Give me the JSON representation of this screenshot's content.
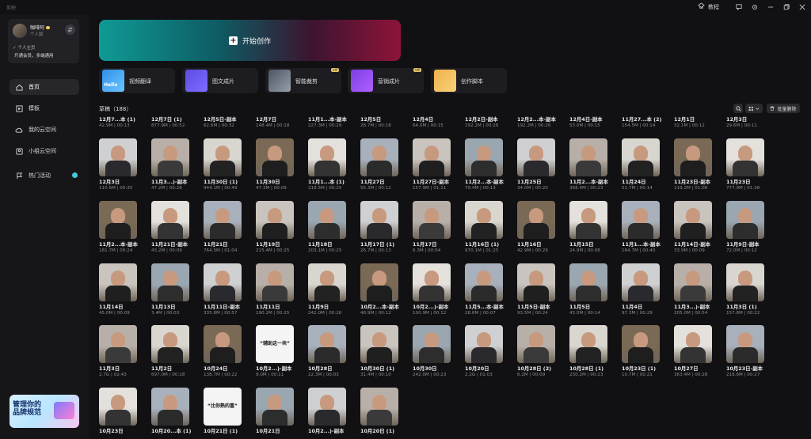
{
  "app": {
    "title": "剪映",
    "tutorial": "教程"
  },
  "sidebar": {
    "user": {
      "name": "咖啡阿",
      "sub": "个人版",
      "page": "个人主页",
      "vip": "开通会员，多端通用"
    },
    "nav": [
      {
        "label": "首页",
        "icon": "home-icon",
        "active": true
      },
      {
        "label": "模板",
        "icon": "template-icon"
      },
      {
        "label": "我的云空间",
        "icon": "cloud-icon"
      },
      {
        "label": "小组云空间",
        "icon": "group-icon"
      },
      {
        "label": "热门活动",
        "icon": "flag-icon"
      }
    ],
    "promo": {
      "line1": "管理你的",
      "line2": "品牌规范"
    }
  },
  "main": {
    "start_label": "开始创作",
    "tools": [
      {
        "label": "视频翻译",
        "thumb": "Hello",
        "vip": ""
      },
      {
        "label": "图文成片",
        "thumb": "",
        "vip": ""
      },
      {
        "label": "智能裁剪",
        "thumb": "",
        "vip": "VIP"
      },
      {
        "label": "营销成片",
        "thumb": "",
        "vip": "VIP"
      },
      {
        "label": "创作脚本",
        "thumb": "",
        "vip": ""
      }
    ],
    "drafts_title": "草稿（188）",
    "batch_delete": "批量删除",
    "header_row": [
      {
        "title": "12月7...本 (1)",
        "meta": "42.9M | 00:13"
      },
      {
        "title": "12月7日 (1)",
        "meta": "877.9M | 00:52"
      },
      {
        "title": "12月5日-副本",
        "meta": "62.6M | 00:32"
      },
      {
        "title": "12月7日",
        "meta": "148.4M | 00:18"
      },
      {
        "title": "11月1...本-副本",
        "meta": "227.3M | 00:29"
      },
      {
        "title": "12月5日",
        "meta": "28.7M | 00:18"
      },
      {
        "title": "12月4日",
        "meta": "64.0M | 00:15"
      },
      {
        "title": "12月2日-副本",
        "meta": "192.2M | 00:26"
      },
      {
        "title": "12月2...本-副本",
        "meta": "192.2M | 00:26"
      },
      {
        "title": "12月4日-副本",
        "meta": "53.0M | 00:15"
      },
      {
        "title": "11月27...本 (2)",
        "meta": "154.5M | 00:14"
      },
      {
        "title": "12月1日",
        "meta": "32.1M | 00:12"
      },
      {
        "title": "12月3日",
        "meta": "29.6M | 00:11"
      }
    ],
    "rows": [
      [
        {
          "title": "12月3日",
          "meta": "110.6M | 00:35"
        },
        {
          "title": "11月3...)-副本",
          "meta": "47.2M | 00:28"
        },
        {
          "title": "11月30日 (1)",
          "meta": "944.1M | 00:49"
        },
        {
          "title": "11月30日",
          "meta": "47.3M | 00:09"
        },
        {
          "title": "11月1...本 (1)",
          "meta": "218.5M | 00:25"
        },
        {
          "title": "11月27日",
          "meta": "55.3M | 00:12"
        },
        {
          "title": "11月27日-副本",
          "meta": "157.9M | 01:11"
        },
        {
          "title": "11月2...本-副本",
          "meta": "79.4M | 00:13"
        },
        {
          "title": "11月25日",
          "meta": "34.0M | 00:20"
        },
        {
          "title": "11月2...本-副本",
          "meta": "368.4M | 00:23"
        },
        {
          "title": "11月24日",
          "meta": "51.7M | 00:14"
        },
        {
          "title": "11月23日-副本",
          "meta": "119.2M | 01:08"
        },
        {
          "title": "11月23日",
          "meta": "777.9M | 01:36"
        }
      ],
      [
        {
          "title": "11月2...本-副本",
          "meta": "181.7M | 00:24"
        },
        {
          "title": "11月21日-副本",
          "meta": "43.2M | 00:09"
        },
        {
          "title": "11月21日",
          "meta": "764.5M | 01:04"
        },
        {
          "title": "11月19日",
          "meta": "215.4M | 00:25"
        },
        {
          "title": "11月18日",
          "meta": "203.1M | 00:25"
        },
        {
          "title": "11月17日 (1)",
          "meta": "26.7M | 00:13"
        },
        {
          "title": "11月17日",
          "meta": "6.3M | 00:04"
        },
        {
          "title": "11月16日 (1)",
          "meta": "970.1M | 01:25"
        },
        {
          "title": "11月16日",
          "meta": "42.9M | 00:29"
        },
        {
          "title": "11月15日",
          "meta": "24.9M | 00:08"
        },
        {
          "title": "11月1...本-副本",
          "meta": "164.7M | 00:40"
        },
        {
          "title": "11月14日-副本",
          "meta": "33.9M | 00:09"
        },
        {
          "title": "11月9日-副本",
          "meta": "72.0M | 00:12"
        }
      ],
      [
        {
          "title": "11月14日",
          "meta": "45.0M | 00:09"
        },
        {
          "title": "11月13日",
          "meta": "3.4M | 00:03"
        },
        {
          "title": "11月11日-副本",
          "meta": "335.8M | 00:57"
        },
        {
          "title": "11月11日",
          "meta": "190.2M | 00:25"
        },
        {
          "title": "11月9日",
          "meta": "242.0M | 00:26"
        },
        {
          "title": "10月2...本-副本",
          "meta": "48.9M | 00:12"
        },
        {
          "title": "10月2...)-副本",
          "meta": "100.9M | 00:12"
        },
        {
          "title": "11月5...本-副本",
          "meta": "28.6M | 00:07"
        },
        {
          "title": "11月5日-副本",
          "meta": "93.5M | 00:24"
        },
        {
          "title": "11月5日",
          "meta": "45.0M | 00:14"
        },
        {
          "title": "11月4日",
          "meta": "97.3M | 00:29"
        },
        {
          "title": "11月3...)-副本",
          "meta": "205.0M | 00:54"
        },
        {
          "title": "11月3日 (1)",
          "meta": "157.8M | 00:22"
        }
      ],
      [
        {
          "title": "11月3日",
          "meta": "2.7G | 02:43"
        },
        {
          "title": "11月2日",
          "meta": "697.0M | 00:18"
        },
        {
          "title": "10月24日",
          "meta": "138.7M | 00:22"
        },
        {
          "title": "10月2...)-副本",
          "meta": "9.0M | 00:11"
        },
        {
          "title": "10月28日",
          "meta": "22.3M | 00:03"
        },
        {
          "title": "10月30日 (1)",
          "meta": "31.4M | 00:10"
        },
        {
          "title": "10月30日",
          "meta": "242.0M | 00:23"
        },
        {
          "title": "10月20日",
          "meta": "2.2G | 01:03"
        },
        {
          "title": "10月28日 (2)",
          "meta": "6.2M | 00:09"
        },
        {
          "title": "10月28日 (1)",
          "meta": "230.2M | 00:23"
        },
        {
          "title": "10月23日 (1)",
          "meta": "10.7M | 00:21"
        },
        {
          "title": "10月27日",
          "meta": "363.4M | 00:28"
        },
        {
          "title": "10月23日-副本",
          "meta": "218.6M | 00:27"
        }
      ],
      [
        {
          "title": "10月23日",
          "meta": ""
        },
        {
          "title": "10月20...本 (1)",
          "meta": ""
        },
        {
          "title": "10月21日 (1)",
          "meta": ""
        },
        {
          "title": "10月21日",
          "meta": ""
        },
        {
          "title": "10月2...)-副本",
          "meta": ""
        },
        {
          "title": "10月20日 (1)",
          "meta": ""
        }
      ]
    ],
    "tile_text": {
      "r3c3": "“辅助这一块”",
      "r4c2": "“比你熟的重”"
    }
  },
  "colors": {
    "bg": "#111114",
    "sidebar": "#161619",
    "accent_teal": "#0f9a95",
    "accent_red": "#8e1339"
  }
}
